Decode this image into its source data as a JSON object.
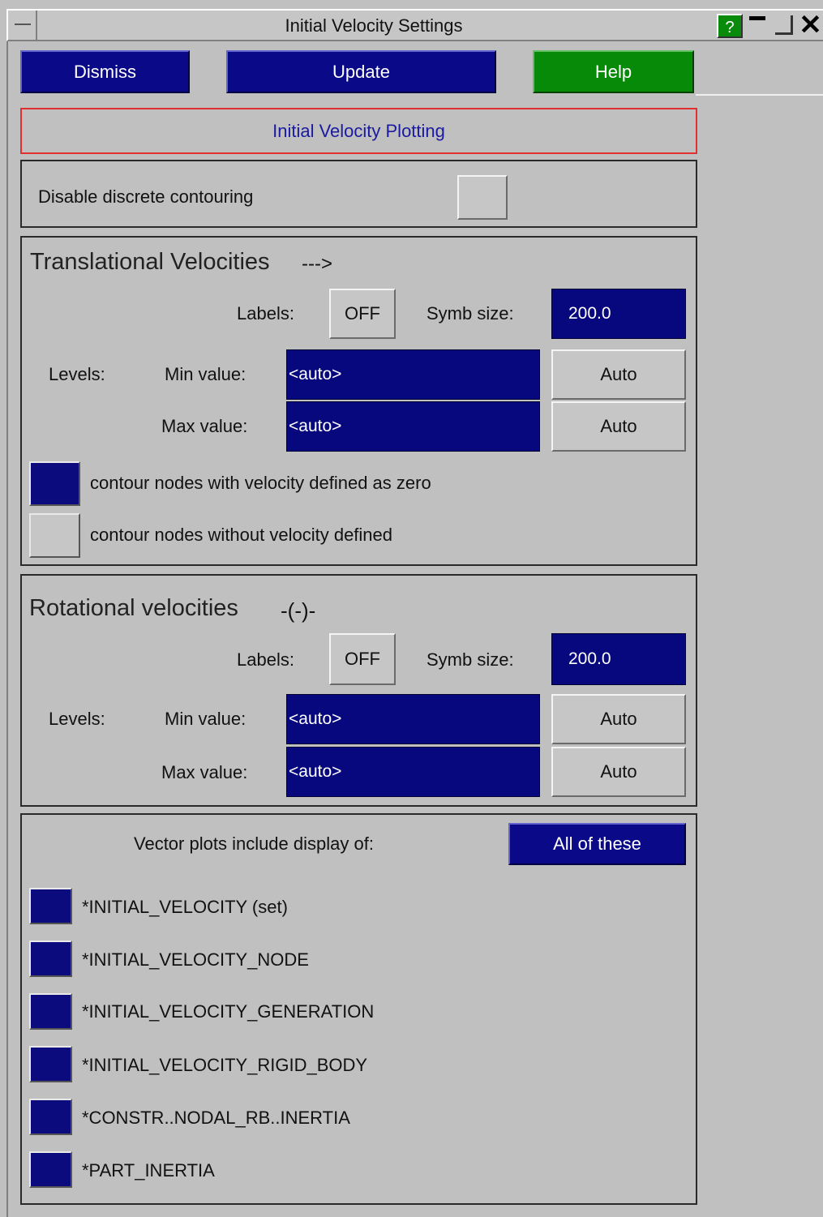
{
  "window": {
    "title": "Initial Velocity Settings",
    "help_glyph": "?",
    "close_glyph": "✕"
  },
  "toolbar": {
    "dismiss_label": "Dismiss",
    "update_label": "Update",
    "help_label": "Help"
  },
  "plotting_header": "Initial Velocity Plotting",
  "disable_discrete": {
    "label": "Disable discrete contouring",
    "checked": false
  },
  "translational": {
    "heading": "Translational Velocities",
    "symbol": "--->",
    "labels_label": "Labels:",
    "labels_toggle": "OFF",
    "symb_size_label": "Symb size:",
    "symb_size_value": "200.0",
    "levels_label": "Levels:",
    "min_label": "Min value:",
    "min_value": "<auto>",
    "min_auto": "Auto",
    "max_label": "Max value:",
    "max_value": "<auto>",
    "max_auto": "Auto",
    "contour_zero_label": "contour nodes with velocity defined as zero",
    "contour_zero_checked": true,
    "contour_undefined_label": "contour nodes without velocity defined",
    "contour_undefined_checked": false
  },
  "rotational": {
    "heading": "Rotational velocities",
    "symbol": "-(-)-",
    "labels_label": "Labels:",
    "labels_toggle": "OFF",
    "symb_size_label": "Symb size:",
    "symb_size_value": "200.0",
    "levels_label": "Levels:",
    "min_label": "Min value:",
    "min_value": "<auto>",
    "min_auto": "Auto",
    "max_label": "Max value:",
    "max_value": "<auto>",
    "max_auto": "Auto"
  },
  "vector_plots": {
    "label": "Vector plots include display of:",
    "all_button": "All of these",
    "items": [
      {
        "label": "*INITIAL_VELOCITY (set)",
        "checked": true
      },
      {
        "label": "*INITIAL_VELOCITY_NODE",
        "checked": true
      },
      {
        "label": "*INITIAL_VELOCITY_GENERATION",
        "checked": true
      },
      {
        "label": "*INITIAL_VELOCITY_RIGID_BODY",
        "checked": true
      },
      {
        "label": "*CONSTR..NODAL_RB..INERTIA",
        "checked": true
      },
      {
        "label": "*PART_INERTIA",
        "checked": true
      }
    ]
  },
  "colors": {
    "background": "#c0c0c0",
    "field_blue": "#08087e",
    "button_blue": "#0a0a88",
    "help_green": "#078a07",
    "header_red_border": "#e03030",
    "header_text": "#1a1aa0"
  }
}
